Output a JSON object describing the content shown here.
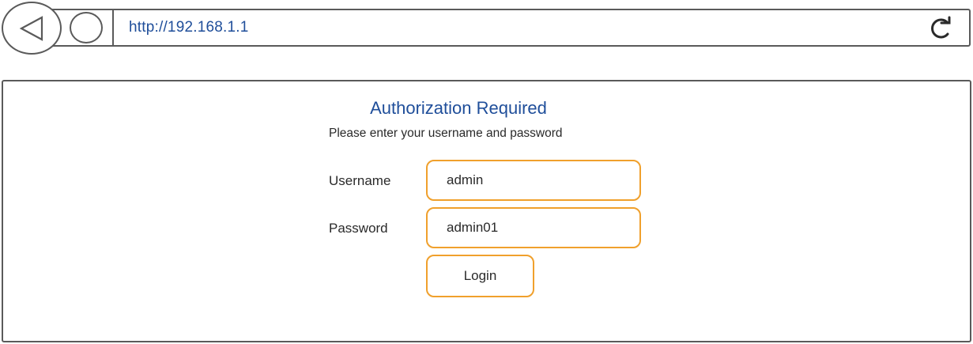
{
  "browser": {
    "url": "http://192.168.1.1",
    "back_icon": "back-triangle-icon",
    "home_icon": "circle-icon",
    "reload_icon": "reload-icon"
  },
  "auth": {
    "title": "Authorization Required",
    "subtitle": "Please enter your username and password",
    "username_label": "Username",
    "username_value": "admin",
    "password_label": "Password",
    "password_value": "admin01",
    "login_label": "Login"
  },
  "colors": {
    "accent_orange": "#f0a02c",
    "link_blue": "#1f4e9a",
    "border_gray": "#5a5a5a"
  }
}
